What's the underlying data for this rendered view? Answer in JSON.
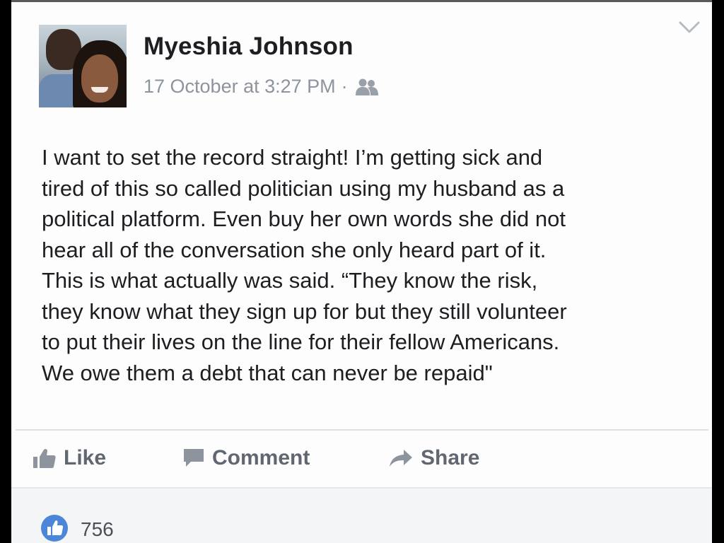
{
  "post": {
    "author": "Myeshia Johnson",
    "timestamp": "17 October at 3:27 PM",
    "separator": "·",
    "audience_icon": "friends-icon",
    "options_icon": "chevron-down-icon",
    "text_lines": [
      "I want to set the record straight! I’m getting sick and",
      "tired of this so called politician using my husband as a",
      "political platform. Even buy her own words she did not",
      "hear all of the conversation she only heard part of it.",
      "This is what actually was said. “They know the risk,",
      "they know what they sign up for but they still volunteer",
      "to put their lives on the line for their fellow Americans.",
      "We owe them a debt that can never be repaid\""
    ]
  },
  "actions": {
    "like_label": "Like",
    "comment_label": "Comment",
    "share_label": "Share"
  },
  "reactions": {
    "icon": "like-badge-icon",
    "count": "756"
  },
  "colors": {
    "text_primary": "#1c1e21",
    "text_secondary": "#8d949e",
    "action_gray": "#606770",
    "like_blue": "#4b86d8"
  }
}
